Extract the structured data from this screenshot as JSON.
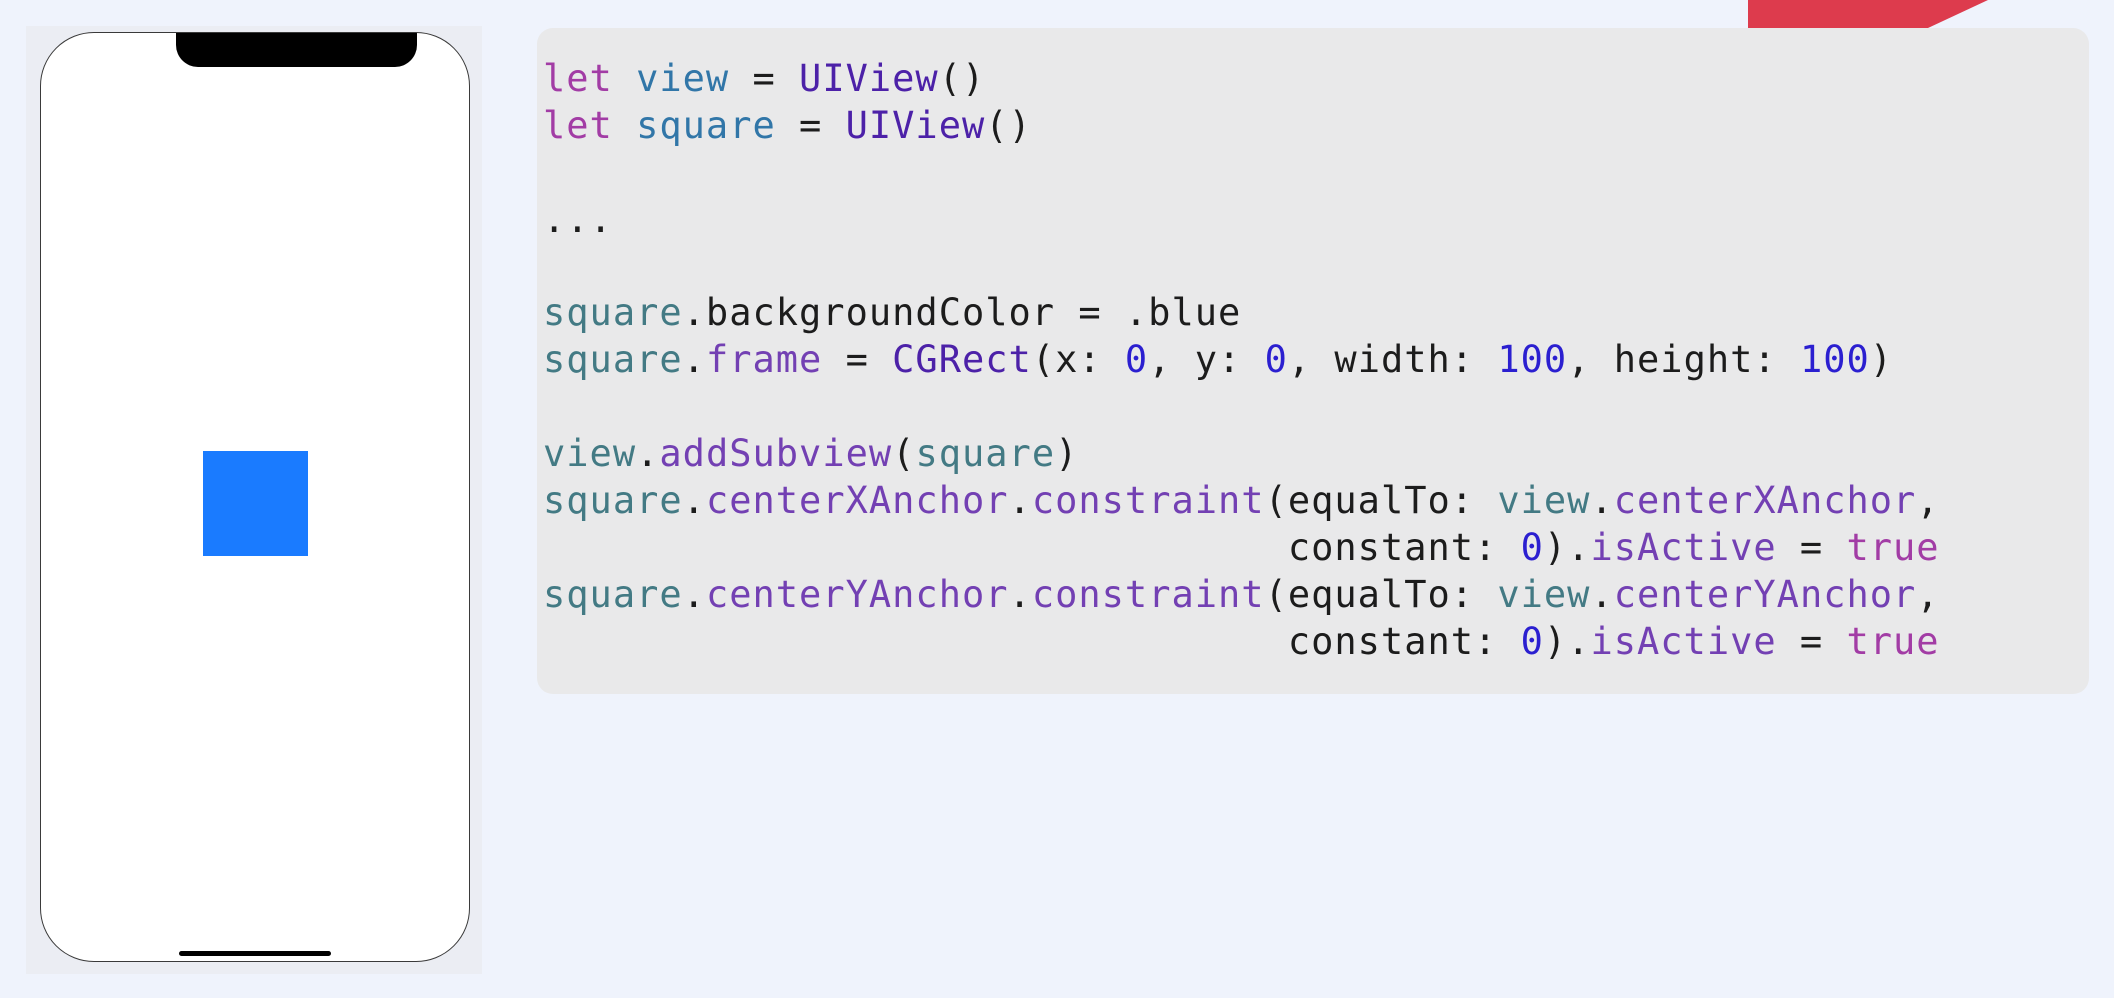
{
  "colors": {
    "page_background": "#eff3fc",
    "phone_screen": "#ffffff",
    "square_fill": "#1a7bff",
    "code_background": "#e9e9ea",
    "accent_corner": "#dd3b4d",
    "syntax_keyword": "#a23ca5",
    "syntax_variable": "#3176a8",
    "syntax_type": "#4c21a8",
    "syntax_reference": "#437a84",
    "syntax_member": "#7340b3",
    "syntax_number": "#2b1fd0"
  },
  "code": {
    "lines": [
      [
        {
          "t": "let",
          "c": "kw"
        },
        {
          "t": " ",
          "c": "pln"
        },
        {
          "t": "view",
          "c": "var"
        },
        {
          "t": " = ",
          "c": "pln"
        },
        {
          "t": "UIView",
          "c": "typ"
        },
        {
          "t": "()",
          "c": "pln"
        }
      ],
      [
        {
          "t": "let",
          "c": "kw"
        },
        {
          "t": " ",
          "c": "pln"
        },
        {
          "t": "square",
          "c": "var"
        },
        {
          "t": " = ",
          "c": "pln"
        },
        {
          "t": "UIView",
          "c": "typ"
        },
        {
          "t": "()",
          "c": "pln"
        }
      ],
      [],
      [
        {
          "t": "...",
          "c": "pln"
        }
      ],
      [],
      [
        {
          "t": "square",
          "c": "ref"
        },
        {
          "t": ".backgroundColor = .blue",
          "c": "pln"
        }
      ],
      [
        {
          "t": "square",
          "c": "ref"
        },
        {
          "t": ".",
          "c": "pln"
        },
        {
          "t": "frame",
          "c": "mem"
        },
        {
          "t": " = ",
          "c": "pln"
        },
        {
          "t": "CGRect",
          "c": "typ"
        },
        {
          "t": "(x: ",
          "c": "pln"
        },
        {
          "t": "0",
          "c": "num"
        },
        {
          "t": ", y: ",
          "c": "pln"
        },
        {
          "t": "0",
          "c": "num"
        },
        {
          "t": ", width: ",
          "c": "pln"
        },
        {
          "t": "100",
          "c": "num"
        },
        {
          "t": ", height: ",
          "c": "pln"
        },
        {
          "t": "100",
          "c": "num"
        },
        {
          "t": ")",
          "c": "pln"
        }
      ],
      [],
      [
        {
          "t": "view",
          "c": "ref"
        },
        {
          "t": ".",
          "c": "pln"
        },
        {
          "t": "addSubview",
          "c": "mem"
        },
        {
          "t": "(",
          "c": "pln"
        },
        {
          "t": "square",
          "c": "ref"
        },
        {
          "t": ")",
          "c": "pln"
        }
      ],
      [
        {
          "t": "square",
          "c": "ref"
        },
        {
          "t": ".",
          "c": "pln"
        },
        {
          "t": "centerXAnchor",
          "c": "mem"
        },
        {
          "t": ".",
          "c": "pln"
        },
        {
          "t": "constraint",
          "c": "mem"
        },
        {
          "t": "(equalTo: ",
          "c": "pln"
        },
        {
          "t": "view",
          "c": "ref"
        },
        {
          "t": ".",
          "c": "pln"
        },
        {
          "t": "centerXAnchor",
          "c": "mem"
        },
        {
          "t": ",",
          "c": "pln"
        }
      ],
      [
        {
          "t": "                                constant: ",
          "c": "pln"
        },
        {
          "t": "0",
          "c": "num"
        },
        {
          "t": ").",
          "c": "pln"
        },
        {
          "t": "isActive",
          "c": "mem"
        },
        {
          "t": " = ",
          "c": "pln"
        },
        {
          "t": "true",
          "c": "kw"
        }
      ],
      [
        {
          "t": "square",
          "c": "ref"
        },
        {
          "t": ".",
          "c": "pln"
        },
        {
          "t": "centerYAnchor",
          "c": "mem"
        },
        {
          "t": ".",
          "c": "pln"
        },
        {
          "t": "constraint",
          "c": "mem"
        },
        {
          "t": "(equalTo: ",
          "c": "pln"
        },
        {
          "t": "view",
          "c": "ref"
        },
        {
          "t": ".",
          "c": "pln"
        },
        {
          "t": "centerYAnchor",
          "c": "mem"
        },
        {
          "t": ",",
          "c": "pln"
        }
      ],
      [
        {
          "t": "                                constant: ",
          "c": "pln"
        },
        {
          "t": "0",
          "c": "num"
        },
        {
          "t": ").",
          "c": "pln"
        },
        {
          "t": "isActive",
          "c": "mem"
        },
        {
          "t": " = ",
          "c": "pln"
        },
        {
          "t": "true",
          "c": "kw"
        }
      ]
    ]
  }
}
